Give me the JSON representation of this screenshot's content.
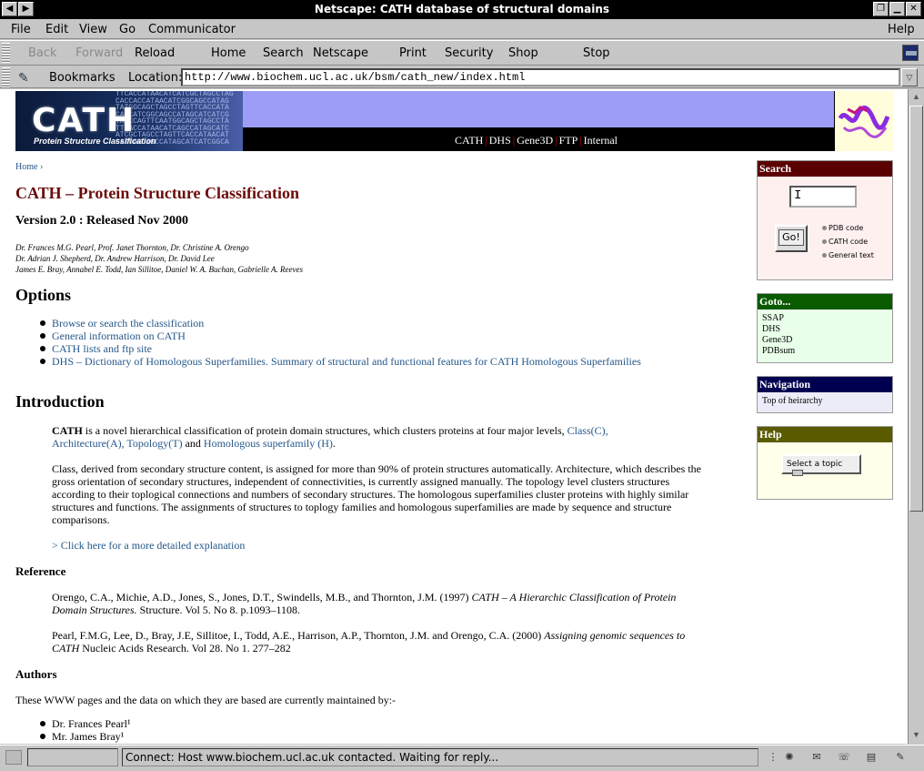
{
  "window": {
    "title": "Netscape: CATH database of structural domains"
  },
  "menu": {
    "file": "File",
    "edit": "Edit",
    "view": "View",
    "go": "Go",
    "communicator": "Communicator",
    "help": "Help"
  },
  "toolbar": {
    "back": "Back",
    "forward": "Forward",
    "reload": "Reload",
    "home": "Home",
    "search": "Search",
    "netscape": "Netscape",
    "print": "Print",
    "security": "Security",
    "shop": "Shop",
    "stop": "Stop"
  },
  "location": {
    "bookmarks": "Bookmarks",
    "label": "Location:",
    "url": "http://www.biochem.ucl.ac.uk/bsm/cath_new/index.html"
  },
  "banner": {
    "logo": "CATH",
    "subtitle": "Protein Structure Classification",
    "nav": [
      "CATH",
      "DHS",
      "Gene3D",
      "FTP",
      "Internal"
    ]
  },
  "page": {
    "breadcrumb": "Home ›",
    "title": "CATH – Protein Structure Classification",
    "version": "Version 2.0 : Released Nov 2000",
    "people": [
      "Dr. Frances M.G. Pearl, Prof. Janet Thornton, Dr. Christine A. Orengo",
      "Dr. Adrian J. Shepherd, Dr. Andrew Harrison, Dr. David Lee",
      "James E. Bray, Annabel E. Todd, Ian Sillitoe, Daniel W. A. Buchan, Gabrielle A. Reeves"
    ],
    "options_heading": "Options",
    "options": [
      "Browse or search the classification",
      "General information on CATH",
      "CATH lists and ftp site",
      "DHS – Dictionary of Homologous Superfamilies. Summary of structural and functional features for CATH Homologous Superfamilies"
    ],
    "intro_heading": "Introduction",
    "intro1": {
      "bold": "CATH",
      "text1": " is a novel hierarchical classification of protein domain structures, which clusters proteins at four major levels, ",
      "class": "Class(C),",
      "arch": "Architecture(A),",
      "topo": "Topology(T)",
      "and": " and ",
      "homol": "Homologous superfamily (H)",
      "end": "."
    },
    "intro2": "Class, derived from secondary structure content, is assigned for more than 90% of protein structures automatically. Architecture, which describes the gross orientation of secondary structures, independent of connectivities, is currently assigned manually. The topology level clusters structures according to their toplogical connections and numbers of secondary structures. The homologous superfamilies cluster proteins with highly similar structures and functions. The assignments of structures to toplogy families and homologous superfamilies are made by sequence and structure comparisons.",
    "more_link": "> Click here for a more detailed explanation",
    "reference_heading": "Reference",
    "ref1": {
      "authors": "Orengo, C.A., Michie, A.D., Jones, S., Jones, D.T., Swindells, M.B., and Thornton, J.M. (1997) ",
      "title": "CATH – A Hierarchic Classification of Protein Domain Structures.",
      "rest": " Structure. Vol 5. No 8. p.1093–1108."
    },
    "ref2": {
      "authors": "Pearl, F.M.G, Lee, D., Bray, J.E, Sillitoe, I., Todd, A.E., Harrison, A.P., Thornton, J.M. and Orengo, C.A. (2000) ",
      "title": "Assigning genomic sequences to CATH",
      "rest": " Nucleic Acids Research. Vol 28. No 1. 277–282"
    },
    "authors_heading": "Authors",
    "authors_intro": "These WWW pages and the data on which they are based are currently maintained by:-",
    "authors": [
      "Dr. Frances Pearl¹",
      "Mr. James Bray¹"
    ]
  },
  "sidebar": {
    "search": {
      "heading": "Search",
      "go": "Go!",
      "options": [
        "PDB code",
        "CATH code",
        "General text"
      ]
    },
    "goto": {
      "heading": "Goto...",
      "items": [
        "SSAP",
        "DHS",
        "Gene3D",
        "PDBsum"
      ]
    },
    "navigation": {
      "heading": "Navigation",
      "item": "Top of heirarchy"
    },
    "help": {
      "heading": "Help",
      "select": "Select a topic"
    }
  },
  "status": {
    "text": "Connect: Host www.biochem.ucl.ac.uk contacted. Waiting for reply..."
  },
  "colors": {
    "search_header": "#5a0000",
    "goto_header": "#0a5a00",
    "nav_header": "#000050",
    "help_header": "#5a5a00",
    "title_red": "#6b0b0b",
    "link_blue": "#24578a"
  }
}
